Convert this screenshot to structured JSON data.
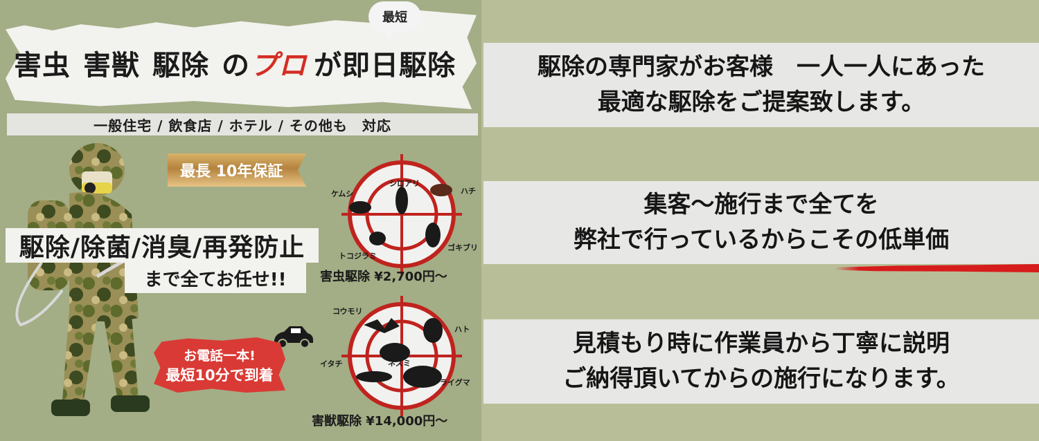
{
  "left": {
    "short_badge": "最短",
    "title_part1": "害虫",
    "title_part2": "害獣",
    "title_part3": "駆除",
    "title_no": "の",
    "title_pro": "プロ",
    "title_end": "が即日駆除",
    "service_targets": "一般住宅 / 飲食店 / ホテル / その他も　対応",
    "guarantee": "最長 10年保証",
    "services_main": "駆除/除菌/消臭/再発防止",
    "services_sub": "まで全てお任せ!!",
    "call_line1": "お電話一本!",
    "call_line2": "最短10分で到着",
    "insect_labels": {
      "kemushi": "ケムシ",
      "shiroari": "シロアリ",
      "hachi": "ハチ",
      "tokojirami": "トコジラミ",
      "gokiburi": "ゴキブリ"
    },
    "insect_price": "害虫駆除 ¥2,700円～",
    "beast_labels": {
      "koumori": "コウモリ",
      "hato": "ハト",
      "itachi": "イタチ",
      "nezumi": "ネズミ",
      "araiguma": "アライグマ"
    },
    "beast_price": "害獣駆除 ¥14,000円～"
  },
  "right": {
    "bar1_line1": "駆除の専門家がお客様　一人一人にあった",
    "bar1_line2": "最適な駆除をご提案致します。",
    "bar2_line1": "集客～施行まで全てを",
    "bar2_line2": "弊社で行っているからこその低単価",
    "bar3_line1": "見積もり時に作業員から丁寧に説明",
    "bar3_line2": "ご納得頂いてからの施行になります。"
  },
  "colors": {
    "background": "#b8bf98",
    "panel": "#a3ad86",
    "accent_red": "#d42d24",
    "gold": "#c9a15a"
  }
}
